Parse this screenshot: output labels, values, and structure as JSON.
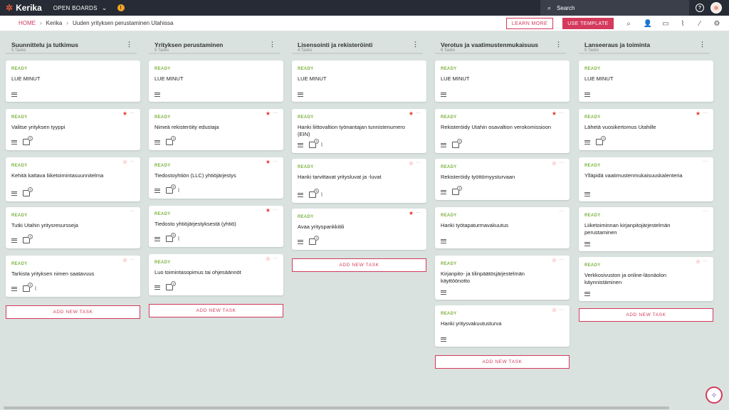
{
  "topbar": {
    "app_name": "Kerika",
    "boards_label": "OPEN BOARDS",
    "notification_icon": "!",
    "search_label": "Search"
  },
  "breadcrumb": {
    "home": "HOME",
    "team": "Kerika",
    "board": "Uuden yrityksen perustaminen Utahissa"
  },
  "header": {
    "learn_more": "LEARN MORE",
    "use_template": "USE TEMPLATE"
  },
  "add_task_label": "ADD NEW TASK",
  "colors": {
    "accent": "#d33a5c",
    "ready": "#7cb342",
    "star": "#e53935",
    "topbar": "#262b35"
  },
  "columns": [
    {
      "title": "Suunnittelu ja tutkimus",
      "count": "5 Tasks",
      "cards": [
        {
          "status": "READY",
          "title": "LUE MINUT",
          "star": "",
          "checklist": "",
          "clip": false
        },
        {
          "status": "READY",
          "title": "Valitse yrityksen tyyppi",
          "star": "★",
          "checklist": "4",
          "clip": false
        },
        {
          "status": "READY",
          "title": "Kehitä kattava liiketoimintasuunnitelma",
          "star": "☆",
          "checklist": "4",
          "clip": false
        },
        {
          "status": "READY",
          "title": "Tutki Utahin yritysresursseja",
          "star": "",
          "checklist": "3",
          "clip": false
        },
        {
          "status": "READY",
          "title": "Tarkista yrityksen nimen saatavuus",
          "star": "☆",
          "checklist": "4",
          "clip": true
        }
      ]
    },
    {
      "title": "Yrityksen perustaminen",
      "count": "5 Tasks",
      "cards": [
        {
          "status": "READY",
          "title": "LUE MINUT",
          "star": "",
          "checklist": "",
          "clip": false
        },
        {
          "status": "READY",
          "title": "Nimeä rekisteröity edustaja",
          "star": "★",
          "checklist": "4",
          "clip": false
        },
        {
          "status": "READY",
          "title": "Tiedostoyhtiön (LLC) yhtiöjärjestys",
          "star": "★",
          "checklist": "5",
          "clip": true
        },
        {
          "status": "READY",
          "title": "Tiedosto yhtiöjärjestyksestä (yhtiö)",
          "star": "★",
          "checklist": "5",
          "clip": true
        },
        {
          "status": "READY",
          "title": "Luo toimintasopimus tai ohjesäännöt",
          "star": "☆",
          "checklist": "4",
          "clip": false
        }
      ]
    },
    {
      "title": "Lisensointi ja rekisteröinti",
      "count": "4 Tasks",
      "cards": [
        {
          "status": "READY",
          "title": "LUE MINUT",
          "star": "",
          "checklist": "",
          "clip": false
        },
        {
          "status": "READY",
          "title": "Hanki liittovaltion työnantajan tunnistenumero (EIN)",
          "star": "★",
          "checklist": "4",
          "clip": true
        },
        {
          "status": "READY",
          "title": "Hanki tarvittavat yritysluvat ja -luvat",
          "star": "☆",
          "checklist": "5",
          "clip": true
        },
        {
          "status": "READY",
          "title": "Avaa yrityspankkitili",
          "star": "★",
          "checklist": "4",
          "clip": false
        }
      ]
    },
    {
      "title": "Verotus ja vaatimustenmukaisuus",
      "count": "6 Tasks",
      "cards": [
        {
          "status": "READY",
          "title": "LUE MINUT",
          "star": "",
          "checklist": "",
          "clip": false
        },
        {
          "status": "READY",
          "title": "Rekisteröidy Utahin osavaltion verokomissioon",
          "star": "★",
          "checklist": "4",
          "clip": false
        },
        {
          "status": "READY",
          "title": "Rekisteröidy työttömyysturvaan",
          "star": "☆",
          "checklist": "2",
          "clip": false
        },
        {
          "status": "READY",
          "title": "Hanki työtapaturmavakuutus",
          "star": "",
          "checklist": "",
          "clip": false
        },
        {
          "status": "READY",
          "title": "Kirjanpito- ja tilinpäätösjärjestelmän käyttöönotto",
          "star": "☆",
          "checklist": "",
          "clip": false
        },
        {
          "status": "READY",
          "title": "Hanki yritysvakuutusturva",
          "star": "☆",
          "checklist": "",
          "clip": false
        }
      ]
    },
    {
      "title": "Lanseeraus ja toiminta",
      "count": "5 Tasks",
      "cards": [
        {
          "status": "READY",
          "title": "LUE MINUT",
          "star": "",
          "checklist": "",
          "clip": false
        },
        {
          "status": "READY",
          "title": "Lähetä vuosikertomus Utahille",
          "star": "★",
          "checklist": "4",
          "clip": false
        },
        {
          "status": "READY",
          "title": "Ylläpidä vaatimustenmukaisuuskalenteria",
          "star": "",
          "checklist": "",
          "clip": false
        },
        {
          "status": "READY",
          "title": "Liiketoiminnan kirjanpitojärjestelmän perustaminen",
          "star": "",
          "checklist": "",
          "clip": false
        },
        {
          "status": "READY",
          "title": "Verkkosivuston ja online-läsnäolon käynnistäminen",
          "star": "☆",
          "checklist": "",
          "clip": false
        }
      ]
    }
  ]
}
